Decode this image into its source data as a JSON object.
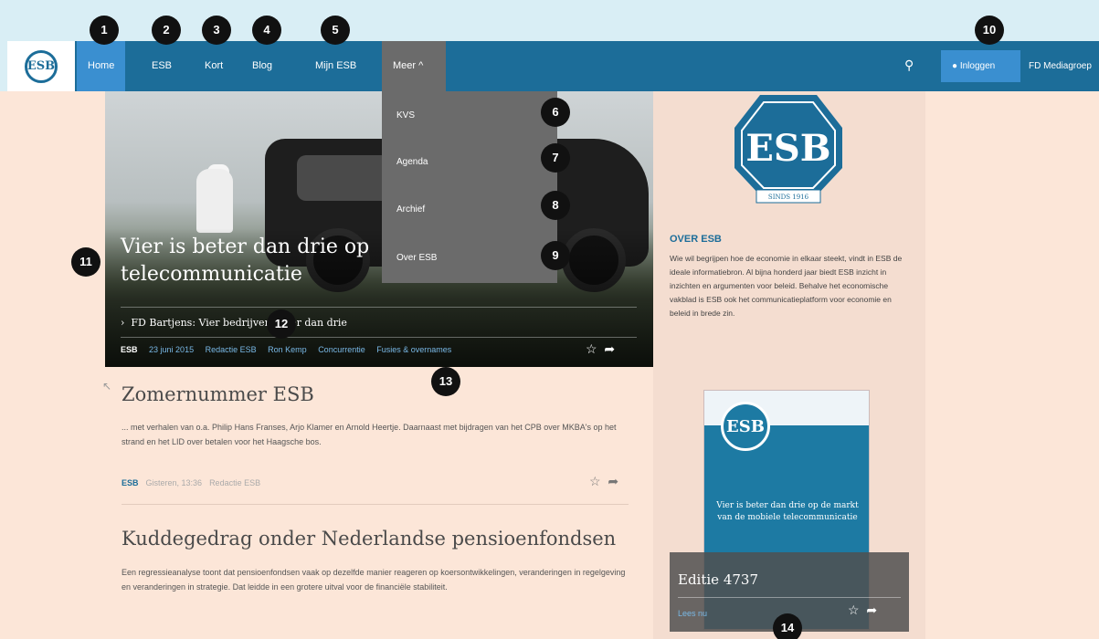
{
  "nav": {
    "logo_text": "ESB",
    "items": [
      {
        "label": "Home"
      },
      {
        "label": "ESB"
      },
      {
        "label": "Kort"
      },
      {
        "label": "Blog"
      },
      {
        "label": "Mijn ESB"
      },
      {
        "label": "Meer ^"
      }
    ],
    "search_icon": "search-icon",
    "login_label": "Inloggen",
    "fd_label": "FD Mediagroep"
  },
  "dropdown": {
    "items": [
      {
        "label": "KVS"
      },
      {
        "label": "Agenda"
      },
      {
        "label": "Archief"
      },
      {
        "label": "Over ESB"
      }
    ]
  },
  "hero": {
    "title": "Vier is beter dan drie op telecommunicatie",
    "subarticle": "FD Bartjens: Vier bedrijven beter dan drie",
    "meta": [
      "ESB",
      "23 juni 2015",
      "Redactie ESB",
      "Ron Kemp",
      "Concurrentie",
      "Fusies & overnames"
    ]
  },
  "articles": [
    {
      "title": "Zomernummer ESB",
      "excerpt": "... met verhalen van o.a. Philip Hans Franses, Arjo Klamer en Arnold Heertje. Daarnaast met bijdragen van het CPB over MKBA's op het strand en het LID over betalen voor het Haagsche bos.",
      "meta": [
        "ESB",
        "Gisteren, 13:36",
        "Redactie ESB"
      ]
    },
    {
      "title": "Kuddegedrag onder Nederlandse pensioenfondsen",
      "excerpt": "Een regressieanalyse toont dat pensioenfondsen vaak op dezelfde manier reageren op koersontwikkelingen, veranderingen in regelgeving en veranderingen in strategie. Dat leidde in een grotere uitval voor de financiële stabiliteit."
    }
  ],
  "sidebar": {
    "heading": "OVER ESB",
    "text": "Wie wil begrijpen hoe de economie in elkaar steekt, vindt in ESB de ideale informatiebron. Al bijna honderd jaar biedt ESB inzicht in inzichten en argumenten voor beleid. Behalve het economische vakblad is ESB ook het communicatieplatform voor economie en beleid in brede zin.",
    "logo_text": "ESB",
    "logo_caption": "SINDS 1916",
    "edition": {
      "cover_text": "Vier is beter dan drie op de markt van de mobiele telecommunicatie",
      "label": "Editie 4737",
      "link": "Lees nu"
    }
  },
  "markers": [
    "1",
    "2",
    "3",
    "4",
    "5",
    "6",
    "7",
    "8",
    "9",
    "10",
    "11",
    "12",
    "13",
    "14"
  ],
  "colors": {
    "nav": "#1c6d99",
    "active": "#3a8fd0",
    "page": "#fce6d8",
    "dropdown": "#6b6b6b"
  }
}
